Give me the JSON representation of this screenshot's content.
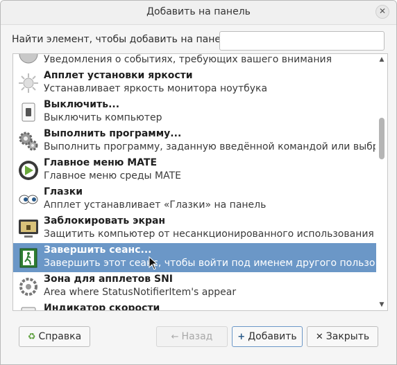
{
  "window": {
    "title": "Добавить на панель"
  },
  "search": {
    "label": "Найти элемент, чтобы добавить на панель:",
    "value": "",
    "placeholder": ""
  },
  "items": [
    {
      "name": "",
      "desc": "Уведомления о событиях, требующих вашего внимания",
      "icon": "notification-icon"
    },
    {
      "name": "Апплет установки яркости",
      "desc": "Устанавливает яркость монитора ноутбука",
      "icon": "brightness-icon"
    },
    {
      "name": "Выключить...",
      "desc": "Выключить компьютер",
      "icon": "power-switch-icon"
    },
    {
      "name": "Выполнить программу...",
      "desc": "Выполнить программу, заданную введённой командой или выбранн...",
      "icon": "gears-icon"
    },
    {
      "name": "Главное меню MATE",
      "desc": "Главное меню среды MATE",
      "icon": "mate-menu-icon"
    },
    {
      "name": "Глазки",
      "desc": "Апплет устанавливает «Глазки» на панель",
      "icon": "eyes-icon"
    },
    {
      "name": "Заблокировать экран",
      "desc": "Защитить компьютер от несанкционированного использования",
      "icon": "lock-screen-icon"
    },
    {
      "name": "Завершить сеанс...",
      "desc": "Завершить этот сеанс, чтобы войти под именем другого пользователя",
      "icon": "logout-icon",
      "selected": true
    },
    {
      "name": "Зона для апплетов SNI",
      "desc": "Area where StatusNotifierItem's appear",
      "icon": "sni-icon"
    },
    {
      "name": "Индикатор скорости",
      "desc": "",
      "icon": "speed-indicator-icon"
    }
  ],
  "buttons": {
    "help": "Справка",
    "back": "Назад",
    "add": "Добавить",
    "close": "Закрыть"
  },
  "colors": {
    "selection": "#6b97c7",
    "background": "#f5f5f5"
  }
}
